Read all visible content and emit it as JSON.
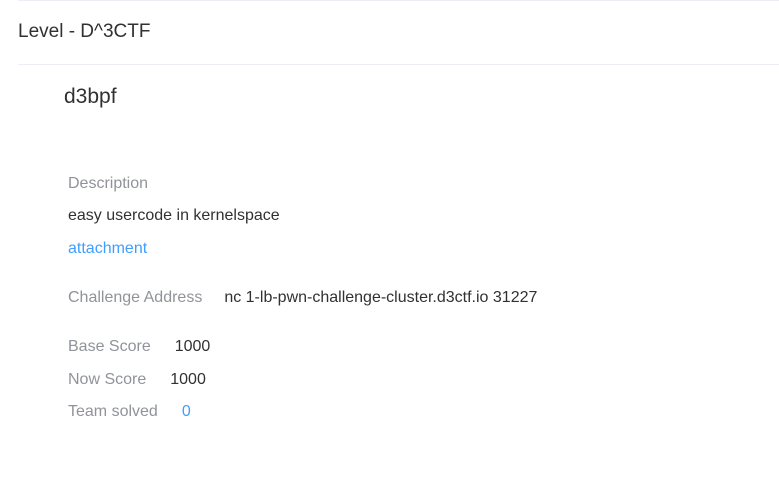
{
  "header": {
    "title": "Level - D^3CTF"
  },
  "challenge": {
    "name": "d3bpf",
    "description_label": "Description",
    "description": "easy usercode in kernelspace",
    "attachment_label": "attachment",
    "address_label": "Challenge Address",
    "address": "nc 1-lb-pwn-challenge-cluster.d3ctf.io 31227",
    "base_score_label": "Base Score",
    "base_score": "1000",
    "now_score_label": "Now Score",
    "now_score": "1000",
    "team_solved_label": "Team solved",
    "team_solved": "0"
  },
  "colors": {
    "label": "#909399",
    "text": "#303133",
    "link": "#409eff",
    "divider": "#ebeef5"
  }
}
